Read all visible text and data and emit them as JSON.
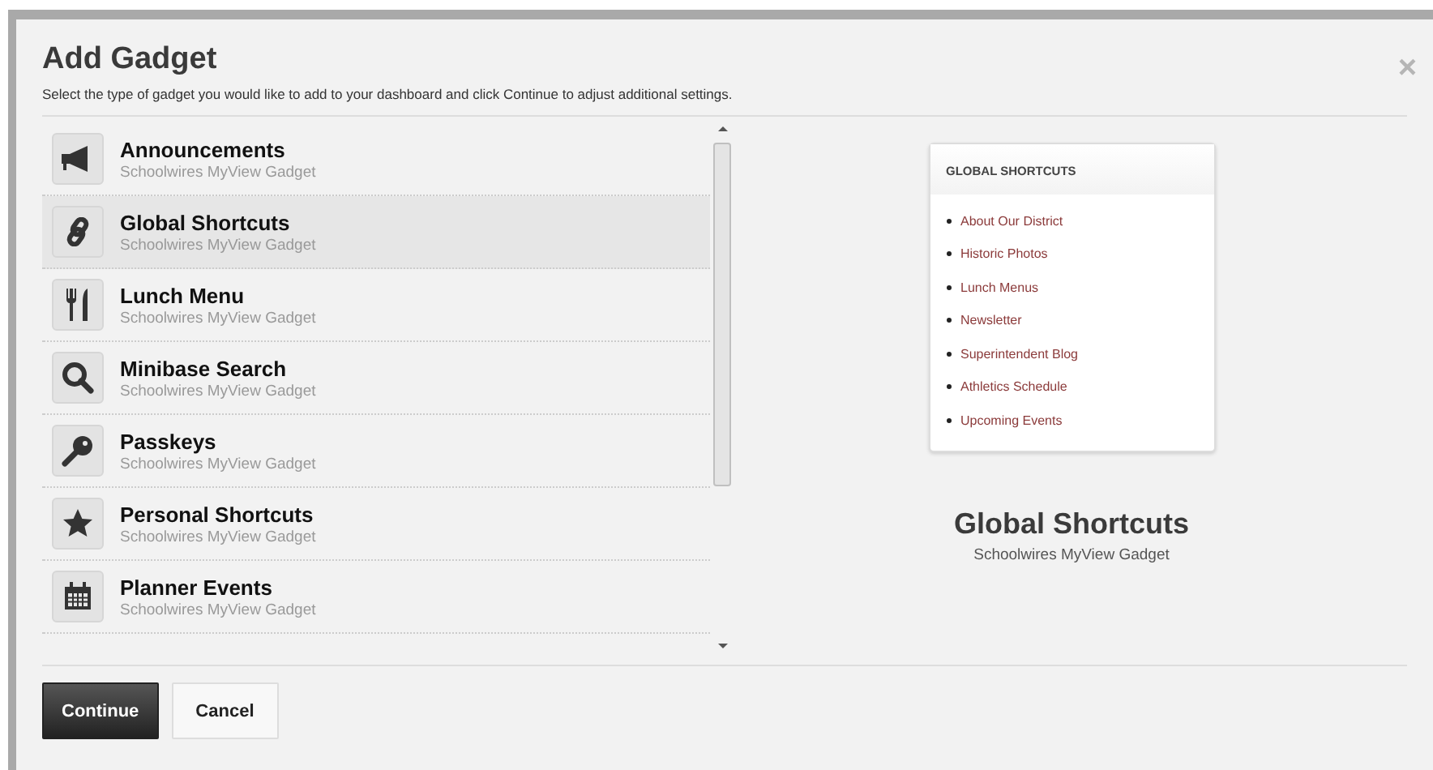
{
  "dialog": {
    "title": "Add Gadget",
    "description": "Select the type of gadget you would like to add to your dashboard and click Continue to adjust additional settings.",
    "close": "×"
  },
  "gadgets": [
    {
      "name": "Announcements",
      "subtitle": "Schoolwires MyView Gadget",
      "selected": false
    },
    {
      "name": "Global Shortcuts",
      "subtitle": "Schoolwires MyView Gadget",
      "selected": true
    },
    {
      "name": "Lunch Menu",
      "subtitle": "Schoolwires MyView Gadget",
      "selected": false
    },
    {
      "name": "Minibase Search",
      "subtitle": "Schoolwires MyView Gadget",
      "selected": false
    },
    {
      "name": "Passkeys",
      "subtitle": "Schoolwires MyView Gadget",
      "selected": false
    },
    {
      "name": "Personal Shortcuts",
      "subtitle": "Schoolwires MyView Gadget",
      "selected": false
    },
    {
      "name": "Planner Events",
      "subtitle": "Schoolwires MyView Gadget",
      "selected": false
    }
  ],
  "preview": {
    "card_title": "GLOBAL SHORTCUTS",
    "links": [
      "About Our District",
      "Historic Photos",
      "Lunch Menus",
      "Newsletter",
      "Superintendent Blog",
      "Athletics Schedule",
      "Upcoming Events"
    ],
    "title": "Global Shortcuts",
    "subtitle": "Schoolwires MyView Gadget"
  },
  "buttons": [
    {
      "label": "Continue",
      "kind": "primary"
    },
    {
      "label": "Cancel",
      "kind": "secondary"
    }
  ]
}
